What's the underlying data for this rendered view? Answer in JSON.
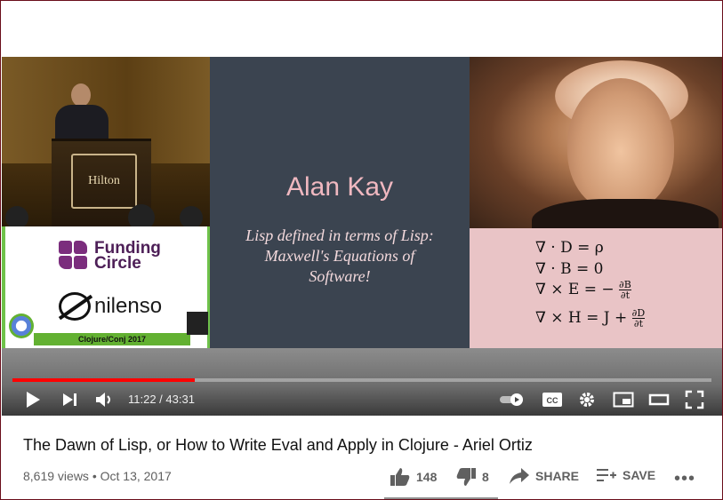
{
  "video": {
    "slide_title": "Alan Kay",
    "slide_quote": [
      "Lisp defined in terms of Lisp:",
      "Maxwell's Equations of",
      "Software!"
    ],
    "podium_sign": "Hilton",
    "sponsors": {
      "funding_line1": "Funding",
      "funding_line2": "Circle",
      "nilenso": "nilenso",
      "conference": "Clojure/Conj 2017",
      "cognitect": "cognitect"
    },
    "equations": {
      "eq1": "∇ · D = ρ",
      "eq2": "∇ · B = 0",
      "eq3_left": "∇ × E = −",
      "eq3_num": "∂B",
      "eq3_den": "∂t",
      "eq4_left": "∇ × H = J +",
      "eq4_num": "∂D",
      "eq4_den": "∂t"
    }
  },
  "player": {
    "current_time": "11:22",
    "duration": "43:31",
    "time_display": "11:22 / 43:31",
    "progress_fraction": 0.261,
    "cc_label": "CC",
    "controls": [
      "play-icon",
      "next-icon",
      "volume-icon",
      "autoplay-toggle",
      "cc-icon",
      "settings-icon",
      "miniplayer-icon",
      "theater-icon",
      "fullscreen-icon"
    ],
    "accent_color": "#ff0000"
  },
  "info": {
    "title": "The Dawn of Lisp, or How to Write Eval and Apply in Clojure - Ariel Ortiz",
    "meta": "8,619 views • Oct 13, 2017",
    "likes": "148",
    "dislikes": "8",
    "share_label": "SHARE",
    "save_label": "SAVE",
    "more_label": "•••"
  }
}
